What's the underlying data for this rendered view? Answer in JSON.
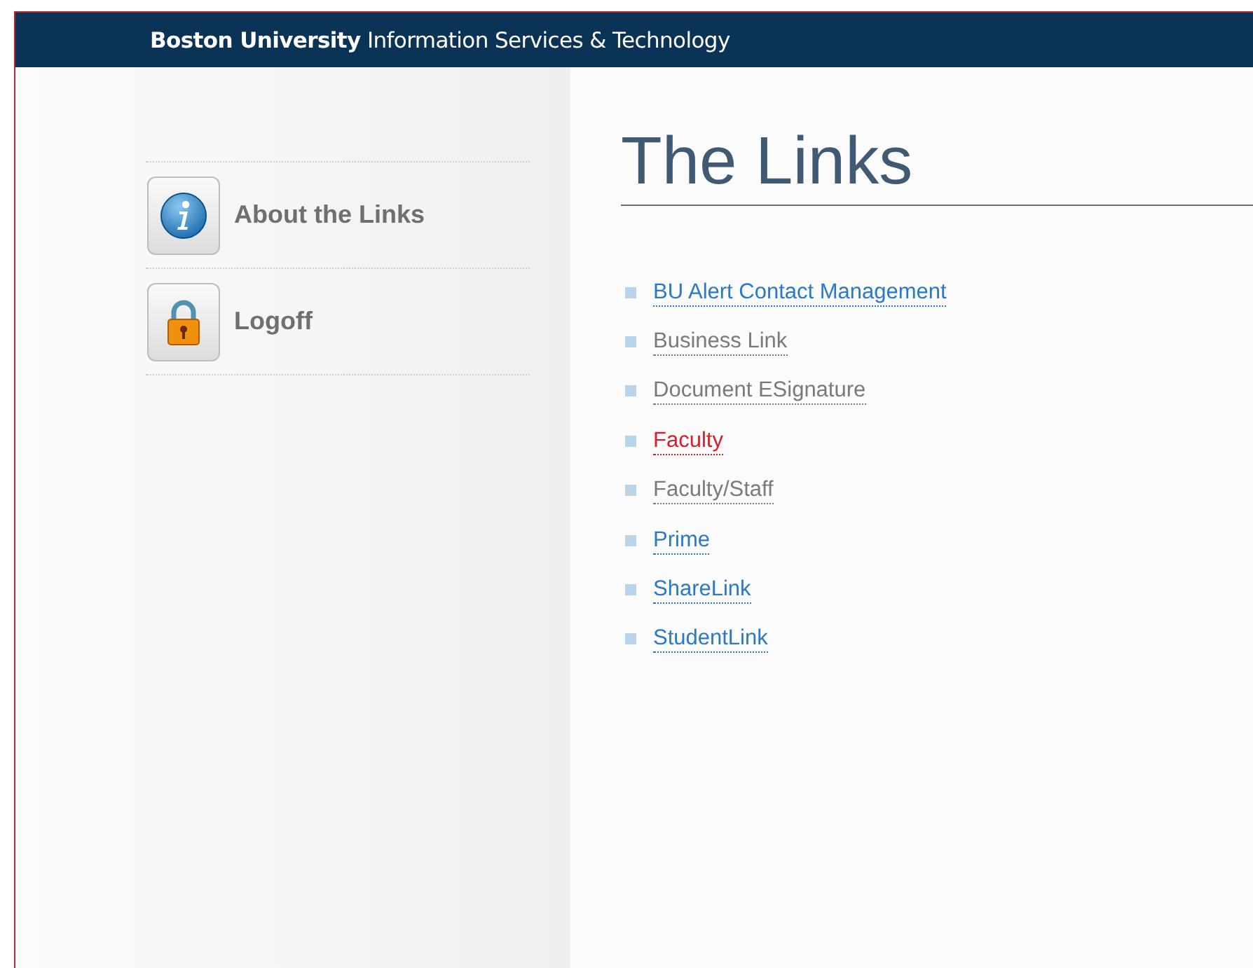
{
  "header": {
    "title": "**Boston University** Information Services & Technology"
  },
  "sidebar": {
    "items": [
      {
        "label": "About the Links",
        "kind": "info"
      },
      {
        "label": "Logoff",
        "kind": "lock"
      }
    ]
  },
  "main": {
    "title": "The Links",
    "links": [
      {
        "label": "BU Alert Contact Management",
        "color": "#2a78c8"
      },
      {
        "label": "Business Link",
        "color": "#7a7a7a"
      },
      {
        "label": "Document ESignature",
        "color": "#7a7a7a"
      },
      {
        "label": "Faculty",
        "color": "#d81e2c"
      },
      {
        "label": "Faculty/Staff",
        "color": "#7a7a7a"
      },
      {
        "label": "Prime",
        "color": "#2a78c8"
      },
      {
        "label": "ShareLink",
        "color": "#2a78c8"
      },
      {
        "label": "StudentLink",
        "color": "#2a78c8"
      }
    ]
  }
}
